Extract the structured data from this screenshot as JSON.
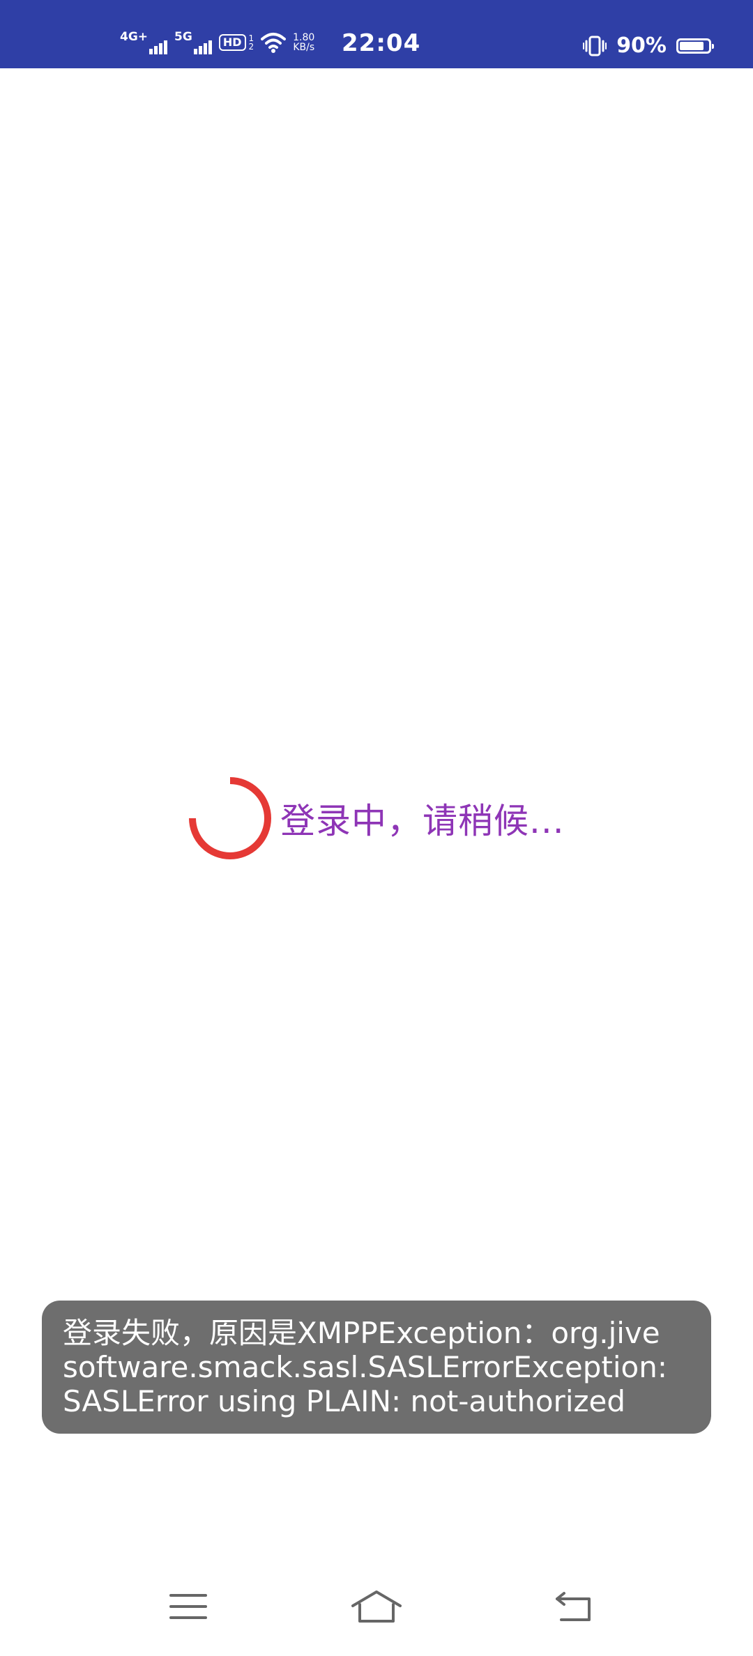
{
  "status_bar": {
    "network1": "4G+",
    "network2": "5G",
    "hd_label": "HD",
    "hd_sub1": "1",
    "hd_sub2": "2",
    "speed_value": "1.80",
    "speed_unit": "KB/s",
    "time": "22:04",
    "battery_percent": "90%",
    "battery_level": 0.9,
    "icons": [
      "signal-icon",
      "signal-icon",
      "hd-icon",
      "wifi-icon",
      "vibrate-icon",
      "battery-icon"
    ]
  },
  "loading": {
    "text": "登录中，请稍候...",
    "spinner_color": "#e53935",
    "text_color": "#8e35b6"
  },
  "toast": {
    "lines": [
      "登录失败，原因是XMPPException：org.jive",
      "software.smack.sasl.SASLErrorException:",
      "SASLError using PLAIN: not-authorized"
    ]
  },
  "navigation": {
    "icons": [
      "menu-icon",
      "home-icon",
      "back-icon"
    ]
  },
  "colors": {
    "status_bar_bg": "#2f3fa6",
    "toast_bg": "#6e6e6e"
  }
}
